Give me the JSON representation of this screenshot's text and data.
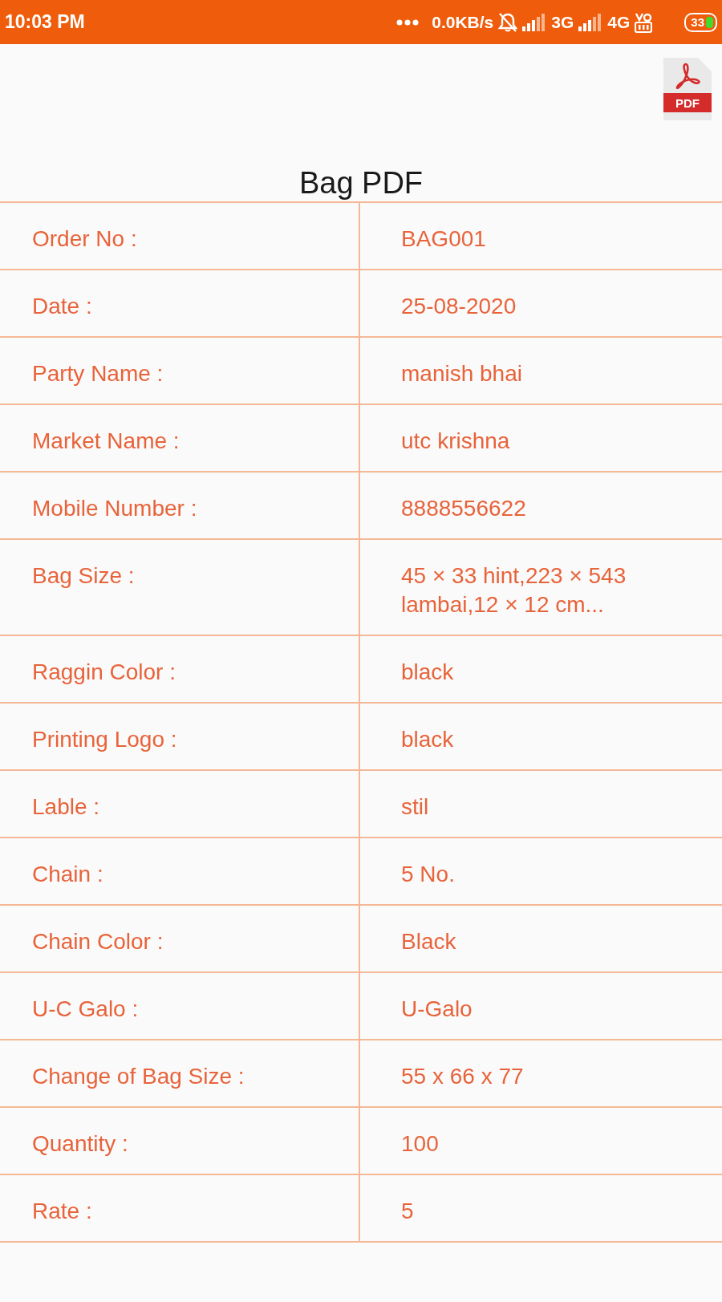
{
  "status_bar": {
    "time": "10:03 PM",
    "data_speed": "0.0KB/s",
    "networks": [
      {
        "label": "3G"
      },
      {
        "label": "4G"
      }
    ],
    "battery": "33"
  },
  "header": {
    "export_button": {
      "label": "PDF"
    },
    "title": "Bag PDF"
  },
  "table": {
    "rows": [
      {
        "label": "Order No :",
        "value": "BAG001"
      },
      {
        "label": "Date :",
        "value": "25-08-2020"
      },
      {
        "label": "Party Name :",
        "value": "manish bhai"
      },
      {
        "label": "Market Name :",
        "value": "utc krishna"
      },
      {
        "label": "Mobile Number :",
        "value": "8888556622"
      },
      {
        "label": "Bag Size :",
        "value": "45 × 33 hint,223 × 543 lambai,12 × 12 cm..."
      },
      {
        "label": "Raggin Color :",
        "value": "black"
      },
      {
        "label": "Printing Logo :",
        "value": "black"
      },
      {
        "label": "Lable :",
        "value": "stil"
      },
      {
        "label": "Chain :",
        "value": "5 No."
      },
      {
        "label": "Chain Color :",
        "value": "Black"
      },
      {
        "label": "U-C Galo :",
        "value": "U-Galo"
      },
      {
        "label": "Change of Bag Size :",
        "value": "55 x 66 x 77"
      },
      {
        "label": "Quantity :",
        "value": "100"
      },
      {
        "label": "Rate :",
        "value": "5"
      }
    ]
  }
}
